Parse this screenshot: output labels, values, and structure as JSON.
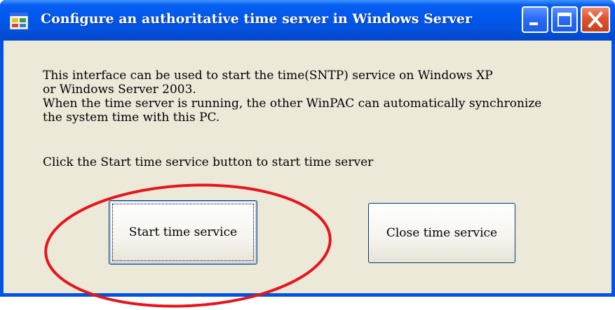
{
  "window": {
    "title": "Configure an authoritative time server in Windows Server",
    "colors": {
      "titlebar": "#0058ee",
      "client": "#ece9d8",
      "close_button": "#e0522e",
      "highlight": "#e8141c"
    },
    "controls": {
      "minimize_icon": "minimize-icon",
      "maximize_icon": "maximize-icon",
      "close_icon": "close-icon"
    }
  },
  "content": {
    "description_lines": [
      "This interface can be used to start the time(SNTP) service on Windows XP",
      "or Windows Server 2003.",
      "When the time server is running, the other WinPAC can automatically synchronize",
      "the system time with this PC."
    ],
    "instruction": "Click the Start time service button to start time server",
    "start_button_label": "Start time service",
    "close_button_label": "Close time service"
  }
}
